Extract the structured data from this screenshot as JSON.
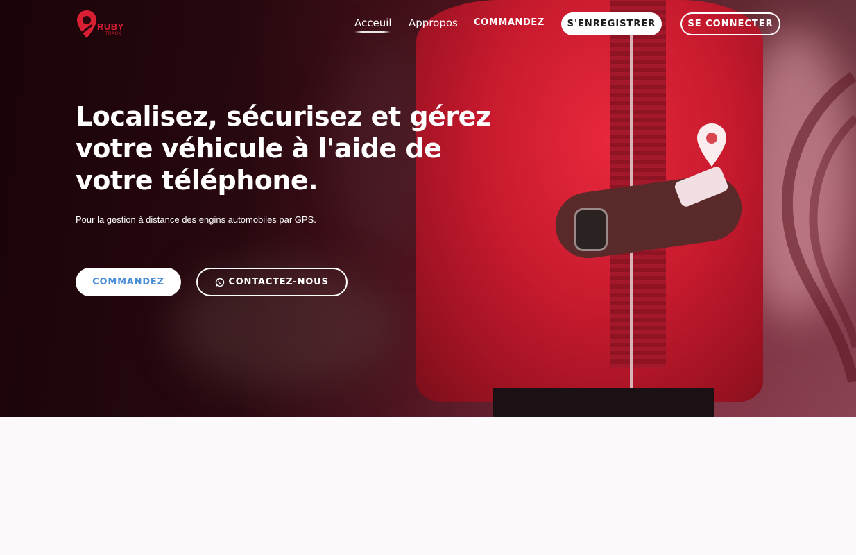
{
  "brand": {
    "name": "RUBY",
    "sub": "TRACK",
    "accent": "#d81f33"
  },
  "nav": {
    "links": [
      {
        "label": "Acceuil"
      },
      {
        "label": "Appropos"
      },
      {
        "label": "COMMANDEZ"
      }
    ],
    "register_label": "S'ENREGISTRER",
    "login_label": "SE CONNECTER"
  },
  "hero": {
    "headline": "Localisez, sécurisez et gérez votre véhicule à l'aide de votre téléphone.",
    "subline": "Pour la gestion à distance des engins automobiles par GPS.",
    "primary_cta": "COMMANDEZ",
    "secondary_cta": "CONTACTEZ-NOUS",
    "secondary_cta_icon": "whatsapp-icon",
    "cta_text_color": "#4a8fd6"
  }
}
